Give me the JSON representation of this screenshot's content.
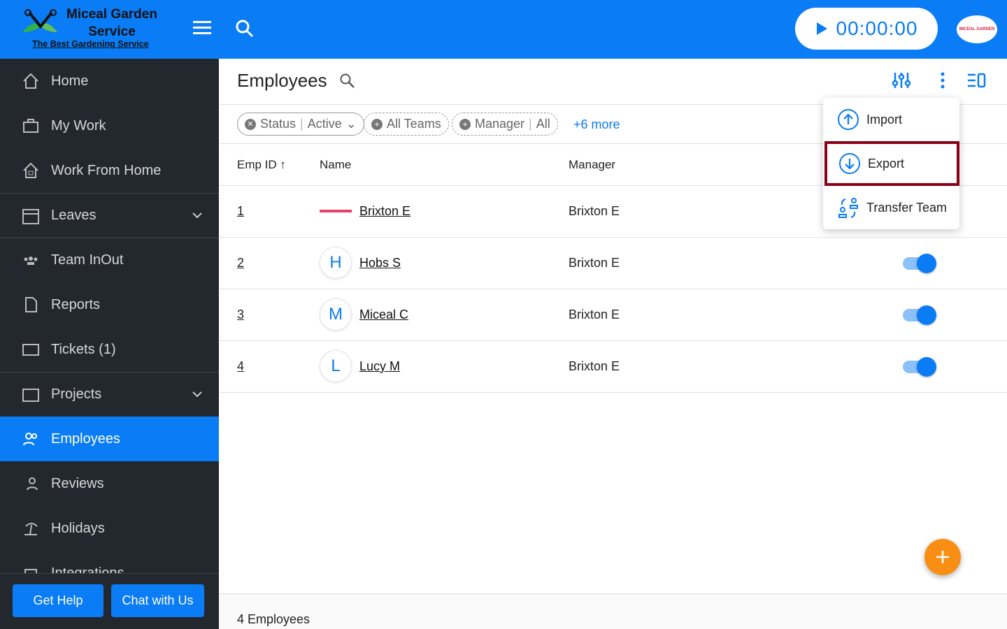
{
  "header": {
    "brand": "Miceal Garden Service",
    "tagline": "The Best Gardening Service",
    "timer": "00:00:00",
    "avatar_text": "MICEAL GARDEN"
  },
  "sidebar": {
    "items": [
      {
        "label": "Home",
        "icon": "home-icon"
      },
      {
        "label": "My Work",
        "icon": "briefcase-icon"
      },
      {
        "label": "Work From Home",
        "icon": "house-icon"
      },
      {
        "label": "Leaves",
        "icon": "calendar-icon"
      },
      {
        "label": "Team InOut",
        "icon": "team-icon"
      },
      {
        "label": "Reports",
        "icon": "report-icon"
      },
      {
        "label": "Tickets (1)",
        "icon": "ticket-icon"
      },
      {
        "label": "Projects",
        "icon": "projects-icon"
      },
      {
        "label": "Employees",
        "icon": "employees-icon"
      },
      {
        "label": "Reviews",
        "icon": "reviews-icon"
      },
      {
        "label": "Holidays",
        "icon": "holidays-icon"
      },
      {
        "label": "Integrations",
        "icon": "integrations-icon"
      }
    ],
    "get_help": "Get Help",
    "chat": "Chat with Us"
  },
  "main": {
    "title": "Employees",
    "filters": {
      "status_label": "Status",
      "status_value": "Active",
      "teams": "All Teams",
      "manager_label": "Manager",
      "manager_value": "All",
      "more": "+6 more"
    },
    "columns": {
      "id": "Emp ID",
      "name": "Name",
      "manager": "Manager"
    },
    "rows": [
      {
        "id": "1",
        "name": "Brixton E",
        "initial": "",
        "manager": "Brixton E",
        "active": true
      },
      {
        "id": "2",
        "name": "Hobs S",
        "initial": "H",
        "manager": "Brixton E",
        "active": true
      },
      {
        "id": "3",
        "name": "Miceal C",
        "initial": "M",
        "manager": "Brixton E",
        "active": true
      },
      {
        "id": "4",
        "name": "Lucy M",
        "initial": "L",
        "manager": "Brixton E",
        "active": true
      }
    ],
    "footer": "4 Employees"
  },
  "menu": {
    "import": "Import",
    "export": "Export",
    "transfer": "Transfer Team"
  },
  "colors": {
    "primary": "#0a7cf5",
    "sidebar": "#22282e",
    "fab": "#f98e14",
    "highlight": "#8b0016"
  }
}
